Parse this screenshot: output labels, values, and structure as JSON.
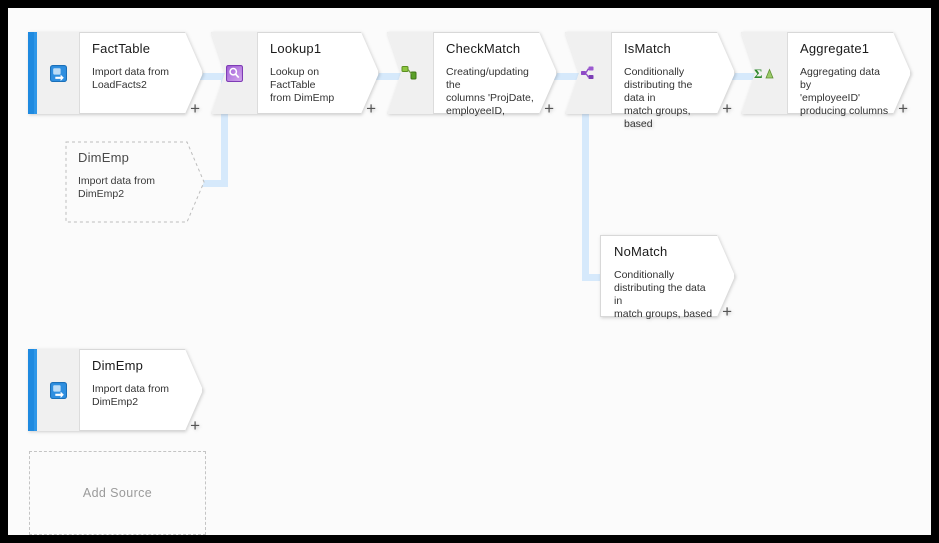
{
  "canvas": {
    "background": "#fbfbfb",
    "border_color": "#000000",
    "connector_color": "#d6e9fb",
    "accent_color": "#1f8ae0"
  },
  "nodes": [
    {
      "id": "facttable",
      "name": "FactTable",
      "description": "Import data from\nLoadFacts2",
      "icon": "source-import-icon",
      "icon_color": "#2f8fe0",
      "kind": "source",
      "plus": "+"
    },
    {
      "id": "dimemp-ghost",
      "name": "DimEmp",
      "description": "Import data from\nDimEmp2",
      "icon": "none",
      "kind": "ghost",
      "plus": ""
    },
    {
      "id": "lookup1",
      "name": "Lookup1",
      "description": "Lookup on FactTable\nfrom DimEmp",
      "icon": "lookup-magnifier-icon",
      "icon_color": "#8b46c8",
      "kind": "process",
      "plus": "+"
    },
    {
      "id": "checkmatch",
      "name": "CheckMatch",
      "description": "Creating/updating the\ncolumns 'ProjDate,\nemployeeID,",
      "icon": "derived-column-icon",
      "icon_color": "#67a52f",
      "kind": "process",
      "plus": "+"
    },
    {
      "id": "ismatch",
      "name": "IsMatch",
      "description": "Conditionally\ndistributing the data in\nmatch groups, based",
      "icon": "conditional-split-icon",
      "icon_color": "#8b46c8",
      "kind": "process",
      "plus": "+"
    },
    {
      "id": "aggregate1",
      "name": "Aggregate1",
      "description": "Aggregating data by\n'employeeID'\nproducing columns",
      "icon": "aggregate-sigma-icon",
      "icon_color": "#4f9b2f",
      "kind": "process",
      "plus": "+"
    },
    {
      "id": "nomatch",
      "name": "NoMatch",
      "description": "Conditionally\ndistributing the data in\nmatch groups, based",
      "icon": "none",
      "kind": "plain",
      "plus": "+"
    },
    {
      "id": "dimemp",
      "name": "DimEmp",
      "description": "Import data from\nDimEmp2",
      "icon": "source-import-icon",
      "icon_color": "#2f8fe0",
      "kind": "source",
      "plus": "+"
    }
  ],
  "add_source": {
    "label": "Add Source"
  }
}
